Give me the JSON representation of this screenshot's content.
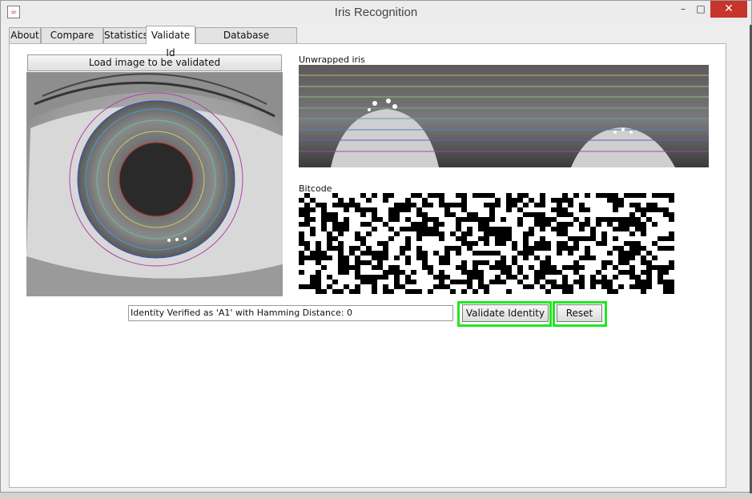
{
  "window": {
    "title": "Iris Recognition",
    "app_icon": "java-cup-icon",
    "minimize_glyph": "–",
    "maximize_glyph": "□",
    "close_glyph": "✕"
  },
  "tabs": [
    {
      "label": "About",
      "active": false
    },
    {
      "label": "Compare Two",
      "active": false
    },
    {
      "label": "Statistics",
      "active": false
    },
    {
      "label": "Validate Id",
      "active": true
    },
    {
      "label": "Database Administration",
      "active": false
    }
  ],
  "validate": {
    "load_button": "Load image to be validated",
    "unwrapped_label": "Unwrapped iris",
    "bitcode_label": "Bitcode",
    "result_text": "Identity Verified as 'A1' with Hamming Distance: 0",
    "validate_button": "Validate Identity",
    "reset_button": "Reset"
  },
  "colors": {
    "highlight_frame": "#22e622",
    "close_button": "#c7342b",
    "panel_bg": "#ffffff"
  }
}
